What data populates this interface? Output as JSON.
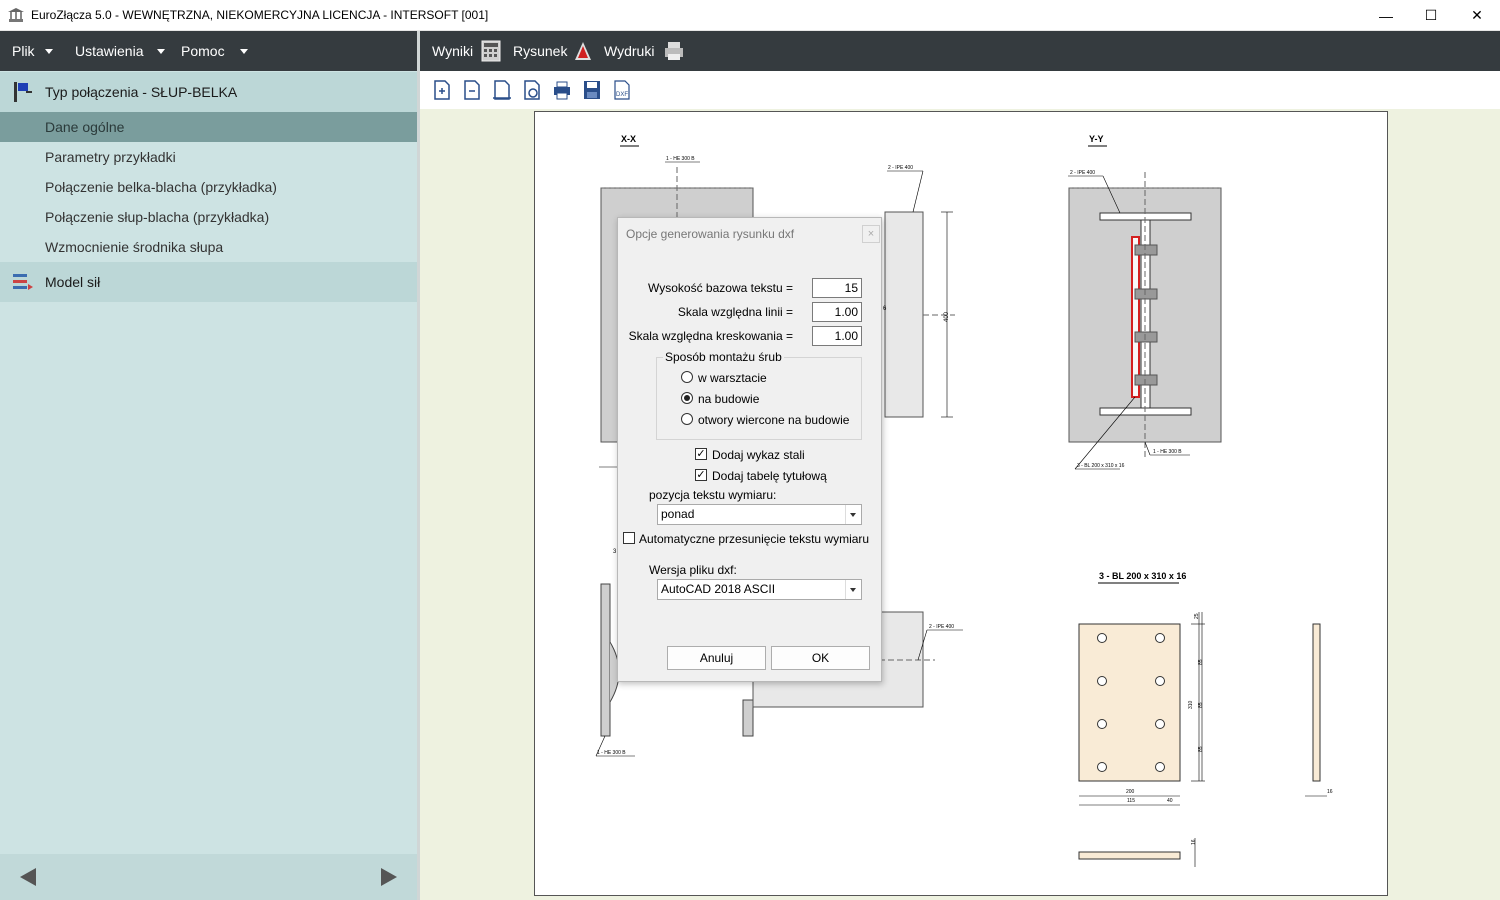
{
  "window": {
    "title": "EuroZłącza 5.0 - WEWNĘTRZNA, NIEKOMERCYJNA LICENCJA - INTERSOFT [001]",
    "min_glyph": "—",
    "max_glyph": "☐",
    "close_glyph": "✕"
  },
  "menubar": {
    "file": "Plik",
    "settings": "Ustawienia",
    "help": "Pomoc"
  },
  "sidebar": {
    "section1": "Typ połączenia - SŁUP-BELKA",
    "items": [
      {
        "label": "Dane ogólne",
        "active": true
      },
      {
        "label": "Parametry przykładki"
      },
      {
        "label": "Połączenie belka-blacha (przykładka)"
      },
      {
        "label": "Połączenie słup-blacha (przykładka)"
      },
      {
        "label": "Wzmocnienie środnika słupa"
      }
    ],
    "section2": "Model sił"
  },
  "toolbar": {
    "results": "Wyniki",
    "drawing": "Rysunek",
    "prints": "Wydruki"
  },
  "drawing": {
    "view_xx": "X-X",
    "view_yy": "Y-Y",
    "label_he300b": "1 - HE 300 B",
    "label_ipe400": "2 - IPE 400",
    "label_plate": "3 - BL 200 x 310 x 16",
    "plate_title": "3 - BL 200 x 310 x 16",
    "dim_400": "400",
    "dim_6": "6",
    "dim_3": "3",
    "dim_25": "25",
    "dim_85a": "85",
    "dim_85b": "85",
    "dim_85c": "85",
    "dim_310": "310",
    "dim_200": "200",
    "dim_115": "115",
    "dim_40": "40",
    "dim_16a": "16",
    "dim_16b": "16",
    "dxf_icon_text": "DXF"
  },
  "dialog": {
    "title": "Opcje generowania rysunku dxf",
    "close_glyph": "×",
    "text_height_label": "Wysokość bazowa tekstu =",
    "text_height_value": "15",
    "line_scale_label": "Skala względna linii =",
    "line_scale_value": "1.00",
    "hatch_scale_label": "Skala względna kreskowania =",
    "hatch_scale_value": "1.00",
    "bolt_group_label": "Sposób montażu śrub",
    "bolt_options": [
      {
        "label": "w warsztacie",
        "selected": false
      },
      {
        "label": "na budowie",
        "selected": true
      },
      {
        "label": "otwory wiercone na budowie",
        "selected": false
      }
    ],
    "add_steel_list": "Dodaj wykaz stali",
    "add_title_table": "Dodaj tabelę tytułową",
    "check_glyph": "✓",
    "dim_text_position_label": "pozycja tekstu wymiaru:",
    "dim_text_position_value": "ponad",
    "auto_shift_label": "Automatyczne przesunięcie tekstu wymiaru",
    "dxf_version_label": "Wersja pliku dxf:",
    "dxf_version_value": "AutoCAD 2018 ASCII",
    "cancel": "Anuluj",
    "ok": "OK"
  }
}
